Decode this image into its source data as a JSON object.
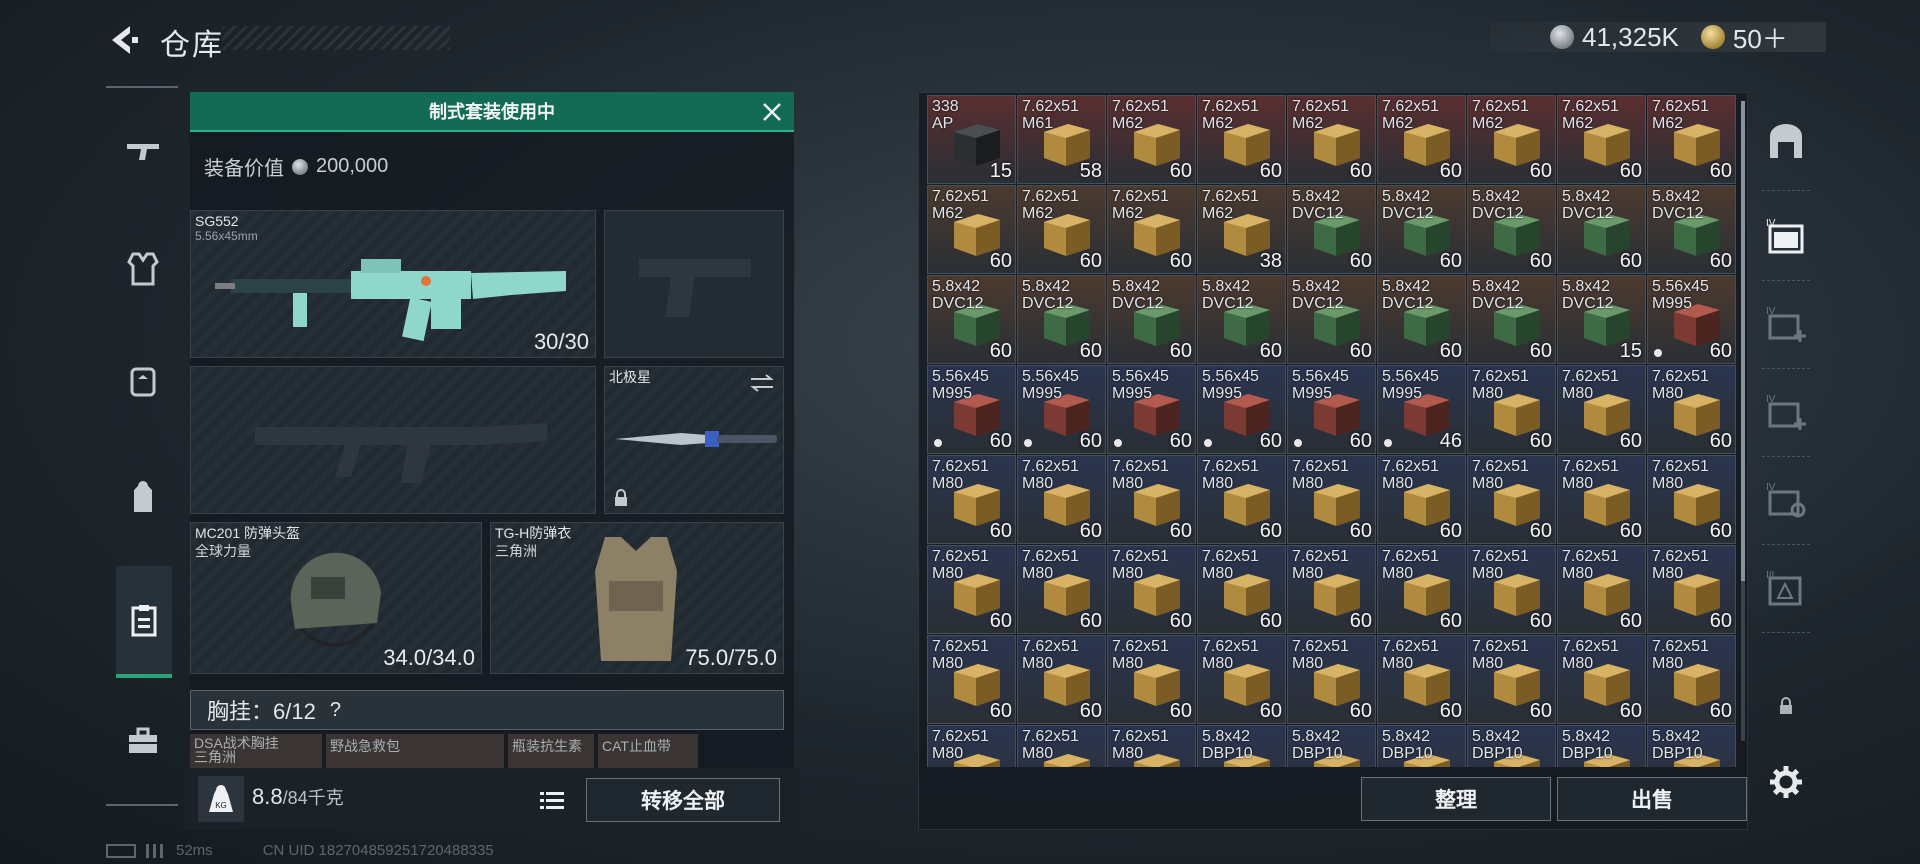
{
  "header": {
    "title": "仓库",
    "currency": [
      {
        "icon": "silver-coin-icon",
        "value": "41,325K"
      },
      {
        "icon": "gold-coin-icon",
        "value": "50＋"
      }
    ]
  },
  "left_nav": [
    {
      "name": "weapons",
      "icon": "rifle-icon",
      "active": false
    },
    {
      "name": "armor",
      "icon": "vest-icon",
      "active": false
    },
    {
      "name": "chest-rig",
      "icon": "rig-icon",
      "active": false
    },
    {
      "name": "backpack",
      "icon": "backpack-icon",
      "active": false
    },
    {
      "name": "loadout",
      "icon": "clipboard-icon",
      "active": true
    },
    {
      "name": "toolkit",
      "icon": "toolbox-icon",
      "active": false
    }
  ],
  "equipment": {
    "kit_banner": "制式套装使用中",
    "value_label": "装备价值",
    "value": "200,000",
    "primary": {
      "name": "SG552",
      "caliber": "5.56x45mm",
      "ammo": "30/30"
    },
    "knife": {
      "name": "北极星"
    },
    "helmet": {
      "name": "MC201 防弹头盔",
      "sub": "全球力量",
      "durability": "34.0/34.0"
    },
    "armor": {
      "name": "TG-H防弹衣",
      "sub": "三角洲",
      "durability": "75.0/75.0"
    },
    "chest_rig": {
      "label": "胸挂：",
      "value": "6/12",
      "help": "?"
    },
    "rig_items": [
      "DSA战术胸挂",
      "三角洲",
      "野战急救包",
      "瓶装抗生素",
      "CAT止血带"
    ],
    "weight": {
      "value": "8.8",
      "max": "/84千克",
      "icon_label": "KG"
    },
    "transfer_all": "转移全部"
  },
  "status": {
    "ping": "52ms",
    "uid": "CN UID 1827048592517204883​35"
  },
  "storage": {
    "rows": [
      [
        [
          "338 AP",
          "15",
          "dark-case"
        ],
        [
          "7.62x51 M61",
          "58",
          "tan"
        ],
        [
          "7.62x51 M62",
          "60",
          "tan"
        ],
        [
          "7.62x51 M62",
          "60",
          "tan"
        ],
        [
          "7.62x51 M62",
          "60",
          "tan"
        ],
        [
          "7.62x51 M62",
          "60",
          "tan"
        ],
        [
          "7.62x51 M62",
          "60",
          "tan"
        ],
        [
          "7.62x51 M62",
          "60",
          "tan"
        ],
        [
          "7.62x51 M62",
          "60",
          "tan"
        ]
      ],
      [
        [
          "7.62x51 M62",
          "60",
          "tan"
        ],
        [
          "7.62x51 M62",
          "60",
          "tan"
        ],
        [
          "7.62x51 M62",
          "60",
          "tan"
        ],
        [
          "7.62x51 M62",
          "38",
          "tan"
        ],
        [
          "5.8x42 DVC12",
          "60",
          "green"
        ],
        [
          "5.8x42 DVC12",
          "60",
          "green"
        ],
        [
          "5.8x42 DVC12",
          "60",
          "green"
        ],
        [
          "5.8x42 DVC12",
          "60",
          "green"
        ],
        [
          "5.8x42 DVC12",
          "60",
          "green"
        ]
      ],
      [
        [
          "5.8x42 DVC12",
          "60",
          "green"
        ],
        [
          "5.8x42 DVC12",
          "60",
          "green"
        ],
        [
          "5.8x42 DVC12",
          "60",
          "green"
        ],
        [
          "5.8x42 DVC12",
          "60",
          "green"
        ],
        [
          "5.8x42 DVC12",
          "60",
          "green"
        ],
        [
          "5.8x42 DVC12",
          "60",
          "green"
        ],
        [
          "5.8x42 DVC12",
          "60",
          "green"
        ],
        [
          "5.8x42 DVC12",
          "15",
          "green"
        ],
        [
          "5.56x45 M995",
          "60",
          "red"
        ]
      ],
      [
        [
          "5.56x45 M995",
          "60",
          "red"
        ],
        [
          "5.56x45 M995",
          "60",
          "red"
        ],
        [
          "5.56x45 M995",
          "60",
          "red"
        ],
        [
          "5.56x45 M995",
          "60",
          "red"
        ],
        [
          "5.56x45 M995",
          "60",
          "red"
        ],
        [
          "5.56x45 M995",
          "46",
          "red"
        ],
        [
          "7.62x51 M80",
          "60",
          "tan"
        ],
        [
          "7.62x51 M80",
          "60",
          "tan"
        ],
        [
          "7.62x51 M80",
          "60",
          "tan"
        ]
      ],
      [
        [
          "7.62x51 M80",
          "60",
          "tan"
        ],
        [
          "7.62x51 M80",
          "60",
          "tan"
        ],
        [
          "7.62x51 M80",
          "60",
          "tan"
        ],
        [
          "7.62x51 M80",
          "60",
          "tan"
        ],
        [
          "7.62x51 M80",
          "60",
          "tan"
        ],
        [
          "7.62x51 M80",
          "60",
          "tan"
        ],
        [
          "7.62x51 M80",
          "60",
          "tan"
        ],
        [
          "7.62x51 M80",
          "60",
          "tan"
        ],
        [
          "7.62x51 M80",
          "60",
          "tan"
        ]
      ],
      [
        [
          "7.62x51 M80",
          "60",
          "tan"
        ],
        [
          "7.62x51 M80",
          "60",
          "tan"
        ],
        [
          "7.62x51 M80",
          "60",
          "tan"
        ],
        [
          "7.62x51 M80",
          "60",
          "tan"
        ],
        [
          "7.62x51 M80",
          "60",
          "tan"
        ],
        [
          "7.62x51 M80",
          "60",
          "tan"
        ],
        [
          "7.62x51 M80",
          "60",
          "tan"
        ],
        [
          "7.62x51 M80",
          "60",
          "tan"
        ],
        [
          "7.62x51 M80",
          "60",
          "tan"
        ]
      ],
      [
        [
          "7.62x51 M80",
          "60",
          "tan"
        ],
        [
          "7.62x51 M80",
          "60",
          "tan"
        ],
        [
          "7.62x51 M80",
          "60",
          "tan"
        ],
        [
          "7.62x51 M80",
          "60",
          "tan"
        ],
        [
          "7.62x51 M80",
          "60",
          "tan"
        ],
        [
          "7.62x51 M80",
          "60",
          "tan"
        ],
        [
          "7.62x51 M80",
          "60",
          "tan"
        ],
        [
          "7.62x51 M80",
          "60",
          "tan"
        ],
        [
          "7.62x51 M80",
          "60",
          "tan"
        ]
      ],
      [
        [
          "7.62x51 M80",
          "",
          "tan"
        ],
        [
          "7.62x51 M80",
          "",
          "tan"
        ],
        [
          "7.62x51 M80",
          "",
          "tan"
        ],
        [
          "5.8x42 DBP10",
          "",
          "tan"
        ],
        [
          "5.8x42 DBP10",
          "",
          "tan"
        ],
        [
          "5.8x42 DBP10",
          "",
          "tan"
        ],
        [
          "5.8x42 DBP10",
          "",
          "tan"
        ],
        [
          "5.8x42 DBP10",
          "",
          "tan"
        ],
        [
          "5.8x42 DBP10",
          "",
          "tan"
        ]
      ]
    ],
    "tier_tint": {
      "dark-case": "#5a2a2e",
      "tan": "#4a3a2e",
      "green": "#4a3a2e",
      "red": "#4a3a2e"
    },
    "row_tint": [
      "#5a2f30",
      "#4c3a2f",
      "#4c3a2f",
      "#2b3550",
      "#2b3550",
      "#2b3550",
      "#2b3550",
      "#2b3550"
    ],
    "sort_button": "整理",
    "sell_button": "出售"
  },
  "right_nav": [
    {
      "name": "safe",
      "icon": "safe-icon"
    },
    {
      "name": "storage-iv-1",
      "icon": "crate-iv-icon",
      "label": "IV"
    },
    {
      "name": "storage-iv-2",
      "icon": "crate-plus-iv-icon",
      "label": "IV"
    },
    {
      "name": "storage-iv-3",
      "icon": "crate-plus-iv-icon",
      "label": "IV"
    },
    {
      "name": "storage-iv-4",
      "icon": "crate-gear-iv-icon",
      "label": "IV"
    },
    {
      "name": "storage-iii",
      "icon": "crate-warning-iii-icon",
      "label": "III"
    },
    {
      "name": "lock",
      "icon": "lock-icon"
    },
    {
      "name": "settings",
      "icon": "gear-icon"
    }
  ],
  "colors": {
    "accent_green": "#28b389",
    "banner_green": "#146b55",
    "rarity_blue": "#2b3550",
    "rarity_red": "#5a2f30"
  }
}
